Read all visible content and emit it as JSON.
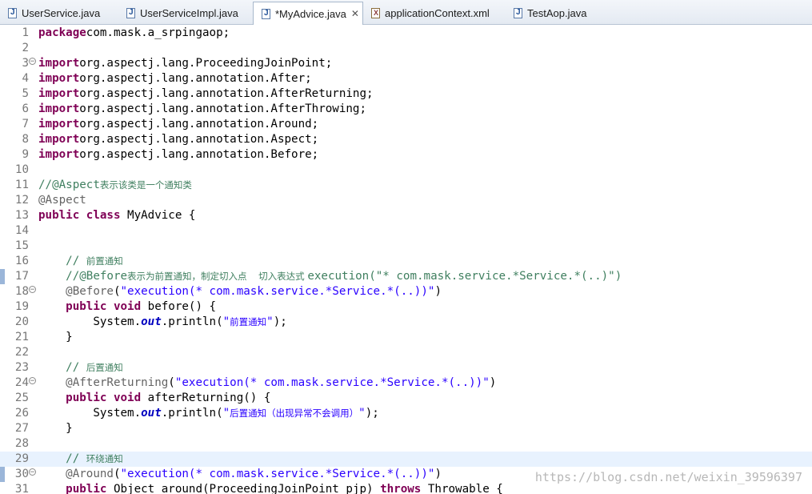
{
  "tabs": [
    {
      "label": "UserService.java",
      "icon": "java-file-icon",
      "active": false
    },
    {
      "label": "UserServiceImpl.java",
      "icon": "java-file-icon",
      "active": false
    },
    {
      "label": "*MyAdvice.java",
      "icon": "java-file-icon",
      "active": true,
      "close": "✕"
    },
    {
      "label": "applicationContext.xml",
      "icon": "xml-file-icon",
      "active": false
    },
    {
      "label": "TestAop.java",
      "icon": "java-file-icon",
      "active": false
    }
  ],
  "editor": {
    "current_line": 29,
    "colors": {
      "keyword": "#7f0055",
      "string": "#2a00ff",
      "comment": "#3f7f5f",
      "annotation": "#646464",
      "field": "#0000c0",
      "current_line_bg": "#e8f2fe"
    },
    "lines": [
      {
        "n": "1",
        "fold": "",
        "tokens": [
          [
            "kw",
            "package"
          ],
          [
            "",
            "com.mask.a_srpingaop;"
          ]
        ]
      },
      {
        "n": "2",
        "fold": "",
        "tokens": []
      },
      {
        "n": "3",
        "fold": "⊖",
        "tokens": [
          [
            "kw",
            "import"
          ],
          [
            "",
            "org.aspectj.lang.ProceedingJoinPoint;"
          ]
        ]
      },
      {
        "n": "4",
        "fold": "",
        "tokens": [
          [
            "kw",
            "import"
          ],
          [
            "",
            "org.aspectj.lang.annotation.After;"
          ]
        ]
      },
      {
        "n": "5",
        "fold": "",
        "tokens": [
          [
            "kw",
            "import"
          ],
          [
            "",
            "org.aspectj.lang.annotation.AfterReturning;"
          ]
        ]
      },
      {
        "n": "6",
        "fold": "",
        "tokens": [
          [
            "kw",
            "import"
          ],
          [
            "",
            "org.aspectj.lang.annotation.AfterThrowing;"
          ]
        ]
      },
      {
        "n": "7",
        "fold": "",
        "tokens": [
          [
            "kw",
            "import"
          ],
          [
            "",
            "org.aspectj.lang.annotation.Around;"
          ]
        ]
      },
      {
        "n": "8",
        "fold": "",
        "tokens": [
          [
            "kw",
            "import"
          ],
          [
            "",
            "org.aspectj.lang.annotation.Aspect;"
          ]
        ]
      },
      {
        "n": "9",
        "fold": "",
        "tokens": [
          [
            "kw",
            "import"
          ],
          [
            "",
            "org.aspectj.lang.annotation.Before;"
          ]
        ]
      },
      {
        "n": "10",
        "fold": "",
        "tokens": []
      },
      {
        "n": "11",
        "fold": "",
        "tokens": [
          [
            "cm",
            "//@Aspect"
          ],
          [
            "cm cn",
            "表示该类是一个通知类"
          ]
        ]
      },
      {
        "n": "12",
        "fold": "",
        "tokens": [
          [
            "an",
            "@Aspect"
          ]
        ]
      },
      {
        "n": "13",
        "fold": "",
        "tokens": [
          [
            "kw",
            "public"
          ],
          [
            "",
            " "
          ],
          [
            "kw",
            "class"
          ],
          [
            "",
            "",
            " MyAdvice {"
          ]
        ]
      },
      {
        "n": "14",
        "fold": "",
        "tokens": []
      },
      {
        "n": "15",
        "fold": "",
        "tokens": []
      },
      {
        "n": "16",
        "fold": "",
        "tokens": [
          [
            "",
            "    "
          ],
          [
            "cm",
            "// "
          ],
          [
            "cm cn",
            "前置通知"
          ]
        ]
      },
      {
        "n": "17",
        "fold": "",
        "tokens": [
          [
            "",
            "    "
          ],
          [
            "cm",
            "//@Before"
          ],
          [
            "cm cn",
            "表示为前置通知，制定切入点    切入表达式 "
          ],
          [
            "cm",
            "execution(\"* com.mask.service.*Service.*(..)\")"
          ]
        ]
      },
      {
        "n": "18",
        "fold": "⊖",
        "tokens": [
          [
            "",
            "    "
          ],
          [
            "an",
            "@Before"
          ],
          [
            "",
            "("
          ],
          [
            "str",
            "\"execution(* com.mask.service.*Service.*(..))\""
          ],
          [
            "",
            ")"
          ]
        ]
      },
      {
        "n": "19",
        "fold": "",
        "tokens": [
          [
            "",
            "    "
          ],
          [
            "kw",
            "public"
          ],
          [
            "",
            " "
          ],
          [
            "kw",
            "void"
          ],
          [
            "",
            " before() {"
          ]
        ]
      },
      {
        "n": "20",
        "fold": "",
        "tokens": [
          [
            "",
            "        System."
          ],
          [
            "fld",
            "out"
          ],
          [
            "",
            ".println("
          ],
          [
            "str",
            "\""
          ],
          [
            "str cn",
            "前置通知"
          ],
          [
            "str",
            "\""
          ],
          [
            "",
            ");"
          ]
        ]
      },
      {
        "n": "21",
        "fold": "",
        "tokens": [
          [
            "",
            "    }"
          ]
        ]
      },
      {
        "n": "22",
        "fold": "",
        "tokens": []
      },
      {
        "n": "23",
        "fold": "",
        "tokens": [
          [
            "",
            "    "
          ],
          [
            "cm",
            "// "
          ],
          [
            "cm cn",
            "后置通知"
          ]
        ]
      },
      {
        "n": "24",
        "fold": "⊖",
        "tokens": [
          [
            "",
            "    "
          ],
          [
            "an",
            "@AfterReturning"
          ],
          [
            "",
            "("
          ],
          [
            "str",
            "\"execution(* com.mask.service.*Service.*(..))\""
          ],
          [
            "",
            ")"
          ]
        ]
      },
      {
        "n": "25",
        "fold": "",
        "tokens": [
          [
            "",
            "    "
          ],
          [
            "kw",
            "public"
          ],
          [
            "",
            " "
          ],
          [
            "kw",
            "void"
          ],
          [
            "",
            " afterReturning() {"
          ]
        ]
      },
      {
        "n": "26",
        "fold": "",
        "tokens": [
          [
            "",
            "        System."
          ],
          [
            "fld",
            "out"
          ],
          [
            "",
            ".println("
          ],
          [
            "str",
            "\""
          ],
          [
            "str cn",
            "后置通知（出现异常不会调用）"
          ],
          [
            "str",
            "\""
          ],
          [
            "",
            ");"
          ]
        ]
      },
      {
        "n": "27",
        "fold": "",
        "tokens": [
          [
            "",
            "    }"
          ]
        ]
      },
      {
        "n": "28",
        "fold": "",
        "tokens": []
      },
      {
        "n": "29",
        "fold": "",
        "tokens": [
          [
            "",
            "    "
          ],
          [
            "cm",
            "// "
          ],
          [
            "cm cn",
            "环绕通知"
          ]
        ]
      },
      {
        "n": "30",
        "fold": "⊖",
        "tokens": [
          [
            "",
            "    "
          ],
          [
            "an",
            "@Around"
          ],
          [
            "",
            "("
          ],
          [
            "str",
            "\"execution(* com.mask.service.*Service.*(..))\""
          ],
          [
            "",
            ")"
          ]
        ]
      },
      {
        "n": "31",
        "fold": "",
        "tokens": [
          [
            "",
            "    "
          ],
          [
            "kw",
            "public"
          ],
          [
            "",
            " Object around(ProceedingJoinPoint pjp) "
          ],
          [
            "kw",
            "throws"
          ],
          [
            "",
            " Throwable {"
          ]
        ]
      }
    ]
  },
  "watermark": "https://blog.csdn.net/weixin_39596397"
}
